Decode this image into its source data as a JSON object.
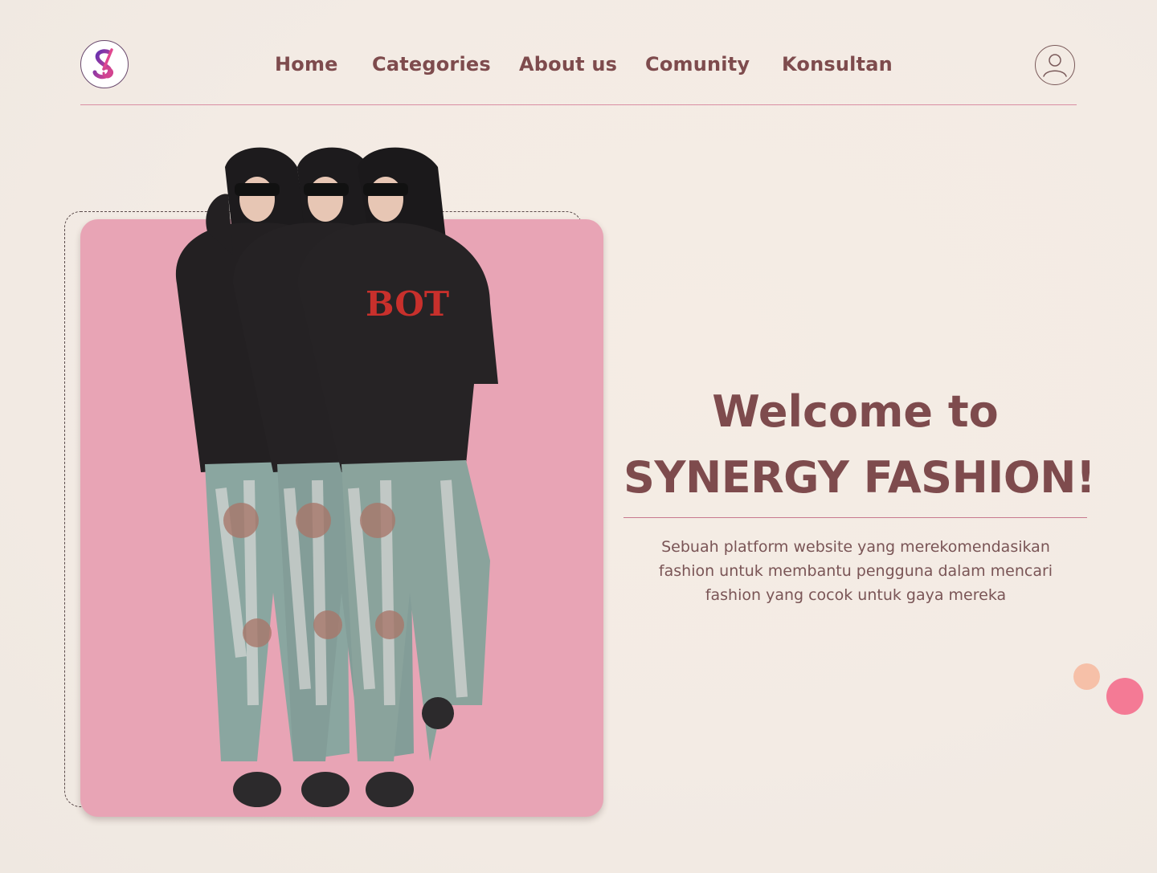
{
  "brand": {
    "logo_letters": "SF",
    "logo_colors": {
      "gradient_start": "#e0478f",
      "gradient_end": "#5b2fb2",
      "ring": "#6a4a6e"
    }
  },
  "nav": {
    "items": [
      {
        "label": "Home"
      },
      {
        "label": "Categories"
      },
      {
        "label": "About us"
      },
      {
        "label": "Comunity"
      },
      {
        "label": "Konsultan"
      }
    ]
  },
  "header": {
    "profile_icon": "user-circle-icon"
  },
  "hero": {
    "image_description_icon": "fashion-models-image",
    "card_color": "#e8a4b5",
    "title_line_1": "Welcome to",
    "title_line_2": "SYNERGY FASHION!",
    "description": "Sebuah platform website yang merekomendasikan fashion untuk membantu pengguna dalam mencari fashion yang cocok untuk gaya mereka"
  },
  "colors": {
    "text_primary": "#7e4b4d",
    "accent_line": "#d98ea3",
    "dot_peach": "#f6c0a8",
    "dot_pink": "#f47a95",
    "background": "#f3ebe4"
  }
}
